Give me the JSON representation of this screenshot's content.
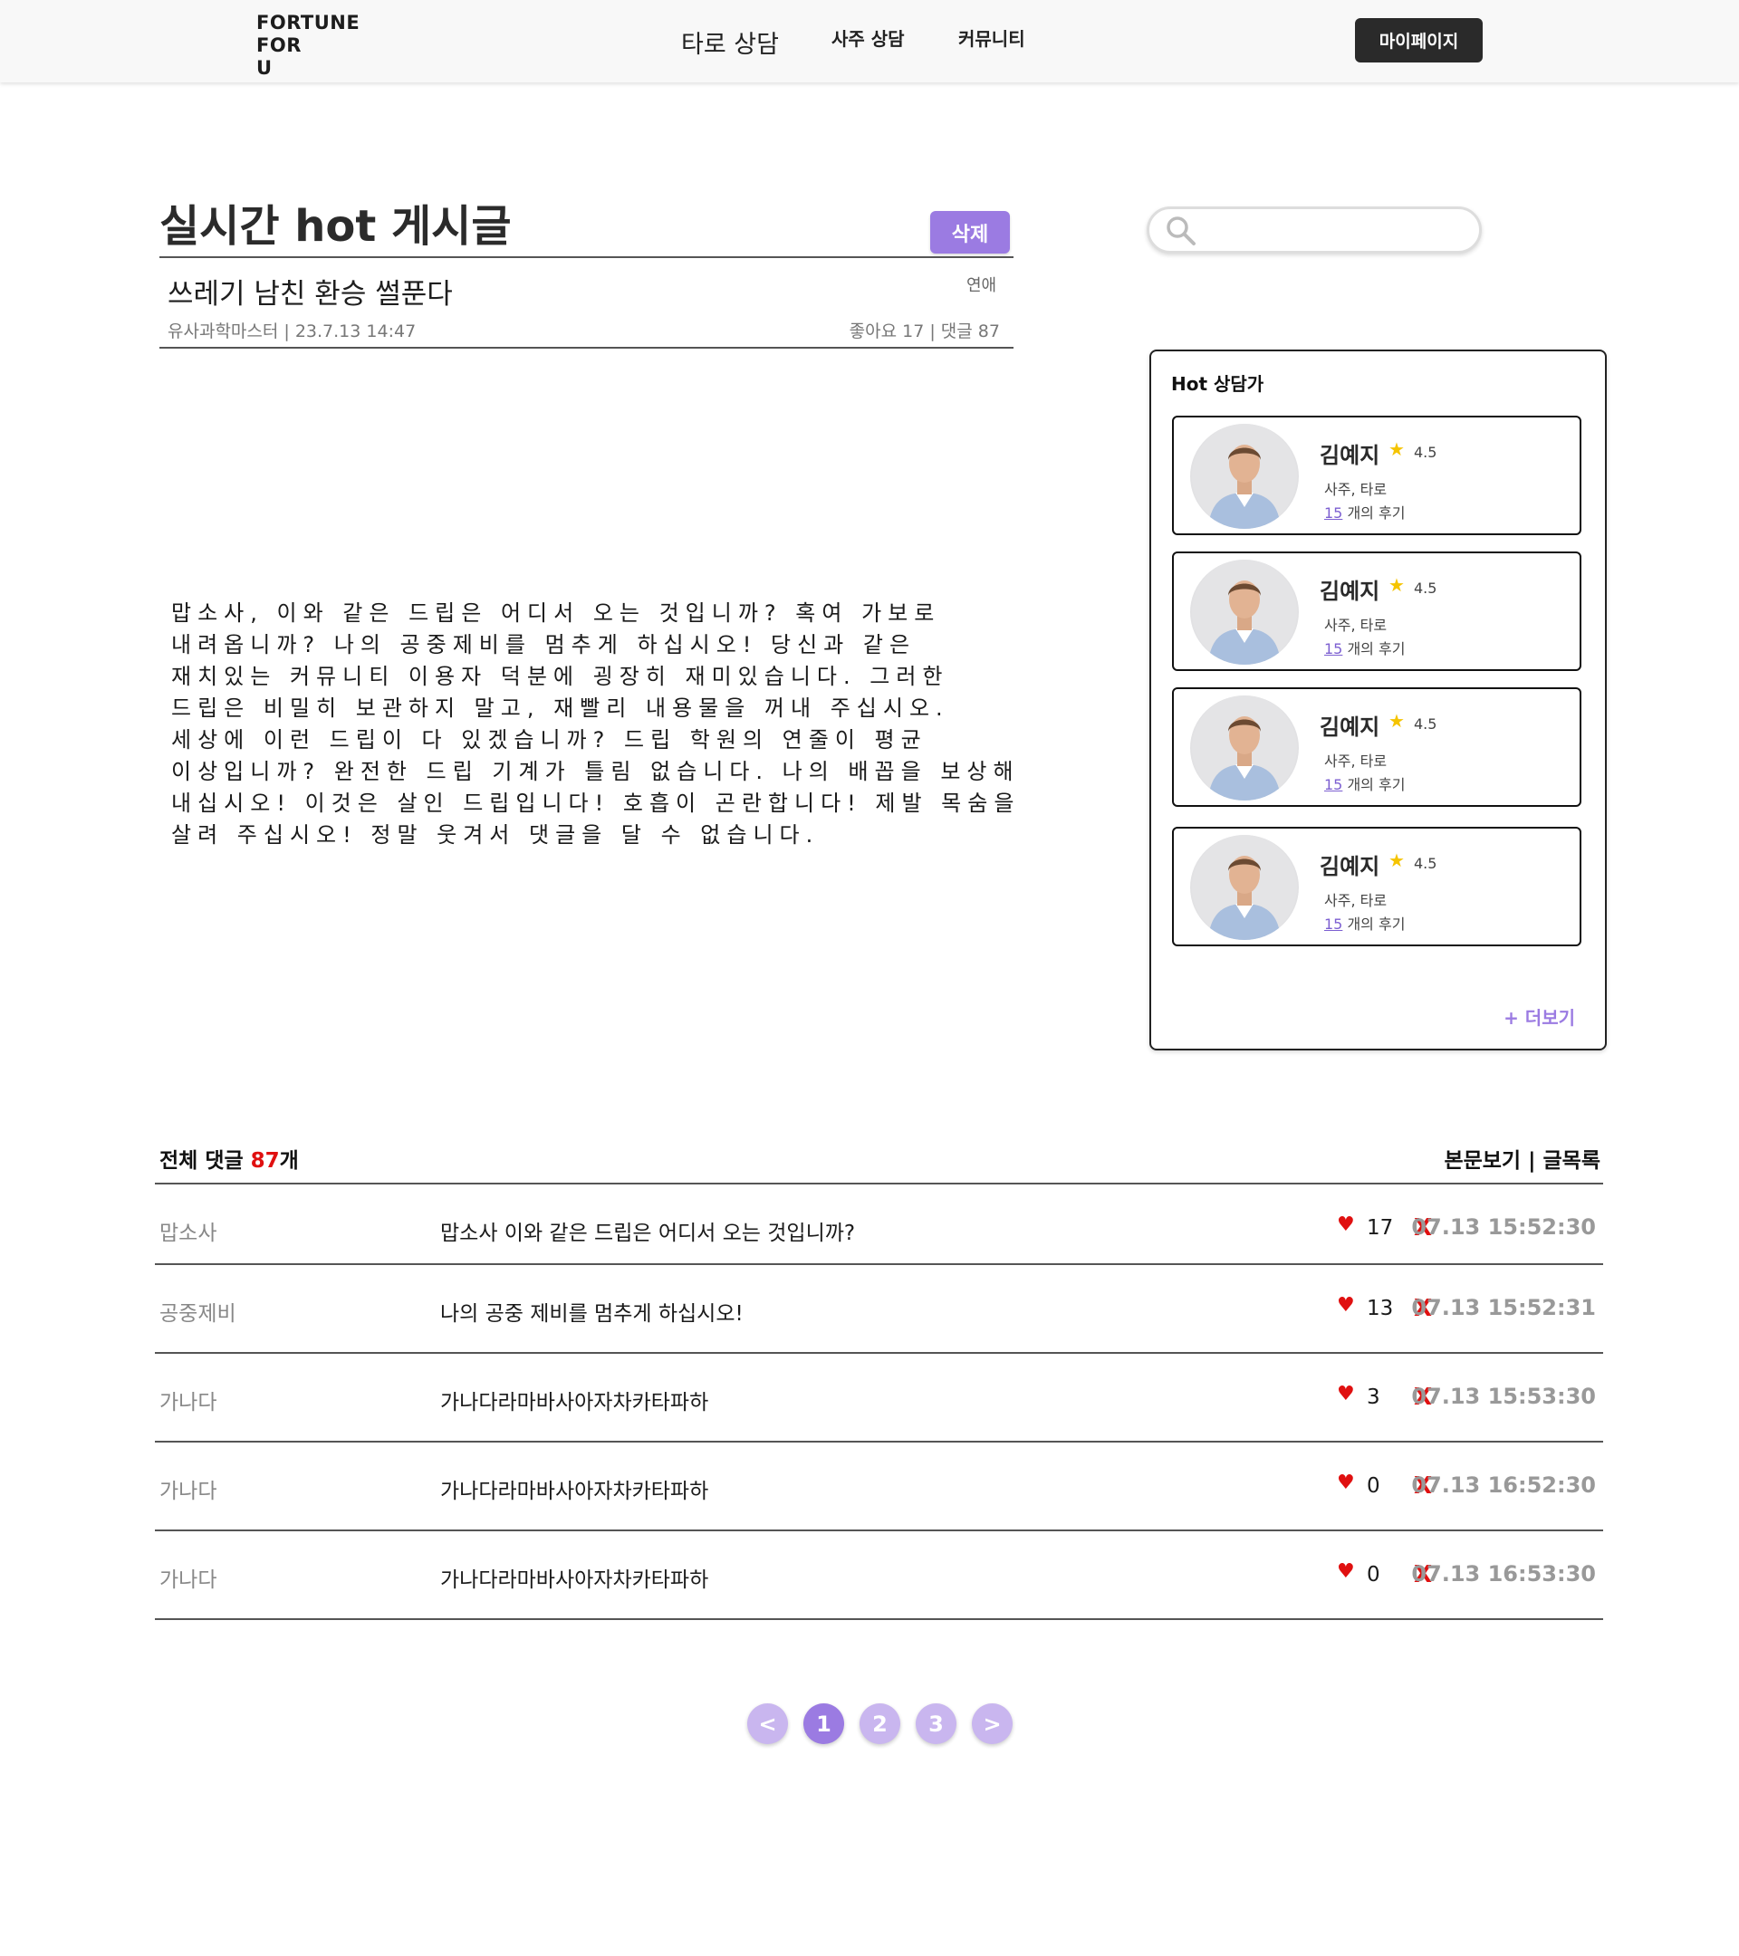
{
  "header": {
    "logo_line1": "FORTUNE",
    "logo_line2": "FOR",
    "logo_line3": "U",
    "nav": [
      "타로 상담",
      "사주 상담",
      "커뮤니티"
    ],
    "mypage_label": "마이페이지"
  },
  "post_section": {
    "page_title": "실시간 hot 게시글",
    "delete_label": "삭제",
    "post_title": "쓰레기 남친 환승 썰푼다",
    "category": "연애",
    "meta": "유사과학마스터 | 23.7.13 14:47",
    "stats": "좋아요 17 | 댓글 87",
    "body": "맙소사, 이와 같은 드립은 어디서 오는 것입니까? 혹여 가보로 내려옵니까? 나의 공중제비를 멈추게 하십시오! 당신과 같은 재치있는 커뮤니티 이용자 덕분에 굉장히 재미있습니다. 그러한 드립은 비밀히 보관하지 말고, 재빨리 내용물을 꺼내 주십시오. 세상에 이런 드립이 다 있겠습니까? 드립 학원의 연줄이 평균 이상입니까? 완전한 드립 기계가 틀림 없습니다.  나의 배꼽을 보상해 내십시오! 이것은 살인 드립입니다! 호흡이 곤란합니다! 제발 목숨을 살려 주십시오! 정말 웃겨서 댓글을 달 수 없습니다."
  },
  "search": {
    "icon": "search-icon",
    "placeholder": ""
  },
  "hot_panel": {
    "title": "Hot 상담가",
    "counselors": [
      {
        "name": "김예지",
        "rating": "4.5",
        "tags": "사주, 타로",
        "review_count": "15",
        "review_suffix": "개의 후기"
      },
      {
        "name": "김예지",
        "rating": "4.5",
        "tags": "사주, 타로",
        "review_count": "15",
        "review_suffix": "개의 후기"
      },
      {
        "name": "김예지",
        "rating": "4.5",
        "tags": "사주, 타로",
        "review_count": "15",
        "review_suffix": "개의 후기"
      },
      {
        "name": "김예지",
        "rating": "4.5",
        "tags": "사주, 타로",
        "review_count": "15",
        "review_suffix": "개의 후기"
      }
    ],
    "more_label": "+ 더보기"
  },
  "comments": {
    "header_prefix": "전체 댓글 ",
    "count": "87",
    "header_suffix": "개",
    "view_links": "본문보기 | 글목록",
    "rows": [
      {
        "author": "맙소사",
        "text": "맙소사 이와 같은 드립은 어디서 오는 것입니까?",
        "likes": "17",
        "delete": "X",
        "time": "07.13 15:52:30"
      },
      {
        "author": "공중제비",
        "text": "나의 공중 제비를 멈추게 하십시오!",
        "likes": "13",
        "delete": "X",
        "time": "07.13 15:52:31"
      },
      {
        "author": "가나다",
        "text": "가나다라마바사아자차카타파하",
        "likes": "3",
        "delete": "X",
        "time": "07.13 15:53:30"
      },
      {
        "author": "가나다",
        "text": "가나다라마바사아자차카타파하",
        "likes": "0",
        "delete": "X",
        "time": "07.13 16:52:30"
      },
      {
        "author": "가나다",
        "text": "가나다라마바사아자차카타파하",
        "likes": "0",
        "delete": "X",
        "time": "07.13 16:53:30"
      }
    ]
  },
  "pagination": {
    "prev": "<",
    "pages": [
      "1",
      "2",
      "3"
    ],
    "next": ">",
    "active_page": "1"
  },
  "colors": {
    "accent": "#9b7be2",
    "accent_light": "#c9b6ef",
    "danger": "#e01010",
    "star": "#f5c400"
  }
}
